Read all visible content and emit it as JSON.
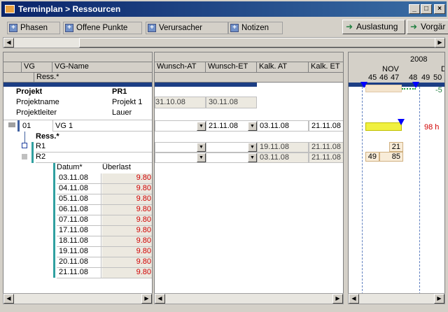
{
  "window": {
    "title": "Terminplan > Ressourcen",
    "min_label": "_",
    "max_label": "□",
    "close_label": "×"
  },
  "toolbar": {
    "tabs": [
      "Phasen",
      "Offene Punkte",
      "Verursacher",
      "Notizen"
    ],
    "auslastung": "Auslastung",
    "vorgaenge": "Vorgär",
    "plus_glyph": "+",
    "arrow_glyph": "➜"
  },
  "grid": {
    "col_vg": "VG",
    "col_vgname": "VG-Name",
    "col_ress": "Ress.*",
    "project": {
      "label": "Projekt",
      "value": "PR1",
      "name_label": "Projektname",
      "name_value": "Projekt 1",
      "leader_label": "Projektleiter",
      "leader_value": "Lauer"
    },
    "row_vg": {
      "id": "01",
      "name": "VG 1"
    },
    "ress_label": "Ress.*",
    "r1": "R1",
    "r2": "R2",
    "overload": {
      "col_date": "Datum*",
      "col_value": "Überlast",
      "rows": [
        [
          "03.11.08",
          "9.80"
        ],
        [
          "04.11.08",
          "9.80"
        ],
        [
          "05.11.08",
          "9.80"
        ],
        [
          "06.11.08",
          "9.80"
        ],
        [
          "07.11.08",
          "9.80"
        ],
        [
          "17.11.08",
          "9.80"
        ],
        [
          "18.11.08",
          "9.80"
        ],
        [
          "19.11.08",
          "9.80"
        ],
        [
          "20.11.08",
          "9.80"
        ],
        [
          "21.11.08",
          "9.80"
        ]
      ]
    }
  },
  "dates": {
    "col_wat": "Wunsch-AT",
    "col_wet": "Wunsch-ET",
    "col_kat": "Kalk. AT",
    "col_ket": "Kalk. ET",
    "project_wat": "31.10.08",
    "project_wet": "30.11.08",
    "vg_wet": "21.11.08",
    "vg_kat": "03.11.08",
    "vg_ket": "21.11.08",
    "r1_kat": "19.11.08",
    "r1_ket": "21.11.08",
    "r2_kat": "03.11.08",
    "r2_ket": "21.11.08"
  },
  "gantt": {
    "year": "2008",
    "month": "NOV",
    "month_next": "D",
    "weeks": [
      "45",
      "46",
      "47",
      "48",
      "49",
      "50"
    ],
    "project_value": "-5",
    "vg_hours": "98 h",
    "r1_value": "21",
    "r2_values": [
      "49",
      "85"
    ],
    "colors": {
      "project_bar": "#f4e4cc",
      "vg_bar": "#f0f040",
      "accent": "#0000ff",
      "red": "#c00000"
    }
  }
}
